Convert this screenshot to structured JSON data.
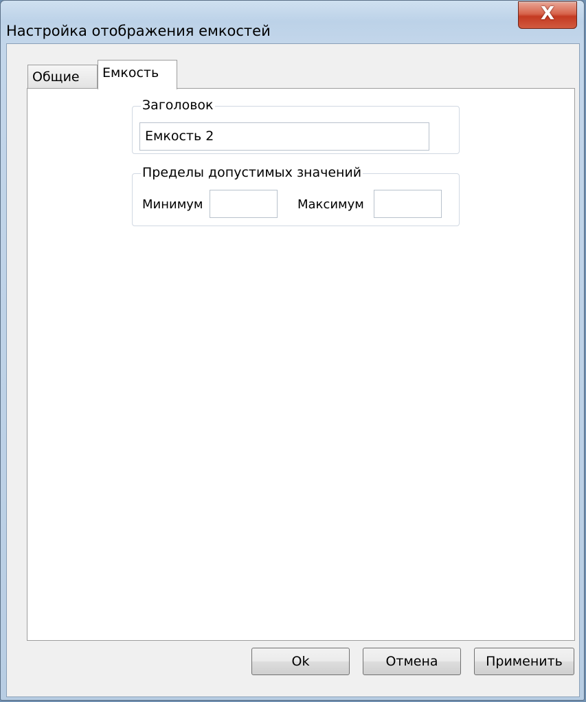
{
  "window": {
    "title": "Настройка отображения емкостей",
    "close_glyph": "X"
  },
  "tabs": {
    "general": "Общие",
    "capacity": "Емкость"
  },
  "header_group": {
    "title": "Заголовок",
    "value": "Емкость 2"
  },
  "limits_group": {
    "title": "Пределы допустимых значений",
    "min_label": "Минимум",
    "min_value": "",
    "max_label": "Максимум",
    "max_value": ""
  },
  "buttons": {
    "ok": "Ok",
    "cancel": "Отмена",
    "apply": "Применить"
  }
}
